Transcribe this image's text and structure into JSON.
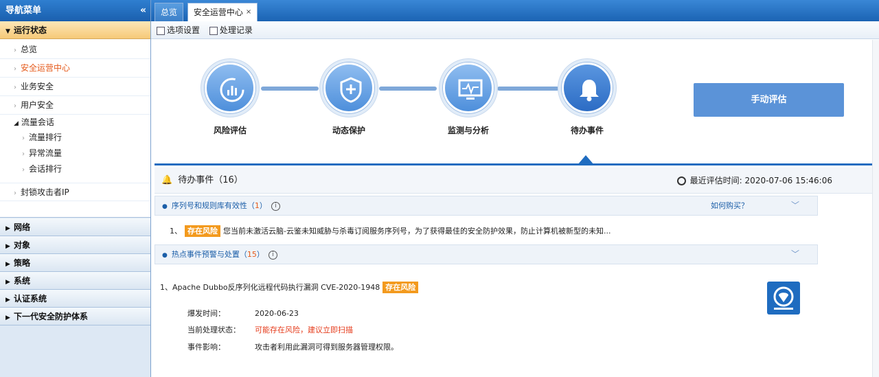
{
  "sidebar": {
    "title": "导航菜单",
    "collapse_icon": "«",
    "open_group": "运行状态",
    "items": [
      {
        "label": "总览"
      },
      {
        "label": "安全运营中心",
        "active": true
      },
      {
        "label": "业务安全"
      },
      {
        "label": "用户安全"
      }
    ],
    "traffic": {
      "label": "流量会话",
      "children": [
        "流量排行",
        "异常流量",
        "会话排行"
      ]
    },
    "block_item": "封锁攻击者IP",
    "groups": [
      "网络",
      "对象",
      "策略",
      "系统",
      "认证系统",
      "下一代安全防护体系"
    ]
  },
  "tabs": [
    {
      "label": "总览",
      "active": false
    },
    {
      "label": "安全运营中心",
      "active": true
    }
  ],
  "tab_close": "×",
  "toolbar": {
    "options_label": "选项设置",
    "records_label": "处理记录"
  },
  "steps": [
    {
      "label": "风险评估",
      "icon": "chart-refresh-icon"
    },
    {
      "label": "动态保护",
      "icon": "shield-plus-icon"
    },
    {
      "label": "监测与分析",
      "icon": "monitor-pulse-icon"
    },
    {
      "label": "待办事件",
      "icon": "bell-icon",
      "active": true
    }
  ],
  "eval_button": "手动评估",
  "pending": {
    "title": "待办事件（16）",
    "time_label": "最近评估时间:",
    "time_value": "2020-07-06 15:46:06"
  },
  "section1": {
    "title": "序列号和规则库有效性（",
    "count": "1",
    "close": "）",
    "buy_link": "如何购买？",
    "row": {
      "index": "1、",
      "badge": "存在风险",
      "text": "您当前未激活云脑-云鉴未知威胁与杀毒订阅服务序列号，为了获得最佳的安全防护效果，防止计算机被新型的未知..."
    }
  },
  "section2": {
    "title": "热点事件预警与处置（",
    "count": "15",
    "close": "）",
    "item": {
      "title": "1、Apache Dubbo反序列化远程代码执行漏洞 CVE-2020-1948",
      "badge": "存在风险",
      "date_label": "爆发时间：",
      "date_value": "2020-06-23",
      "status_label": "当前处理状态：",
      "status_value": "可能存在风险，建议立即扫描",
      "impact_label": "事件影响：",
      "impact_value": "攻击者利用此漏洞可得到服务器管理权限。"
    }
  },
  "colors": {
    "accent_blue": "#1f6cc0",
    "risk_orange": "#f39a1e",
    "active_red": "#e55a1b"
  }
}
